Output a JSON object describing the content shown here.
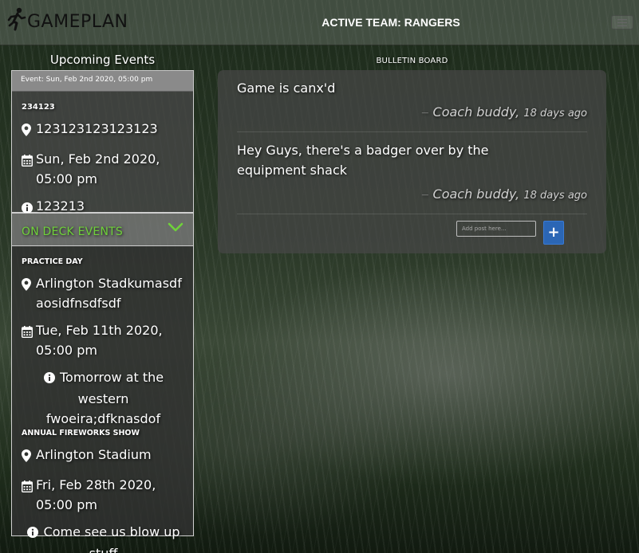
{
  "navbar": {
    "brand": "GAMEPLAN",
    "active_team": "ACTIVE TEAM: RANGERS"
  },
  "upcoming": {
    "heading": "Upcoming Events",
    "selected_label": "Event: Sun, Feb 2nd 2020, 05:00 pm",
    "event": {
      "title": "234123",
      "location": "123123123123123",
      "datetime": "Sun, Feb 2nd 2020, 05:00 pm",
      "info": "123213"
    }
  },
  "on_deck": {
    "heading": "ON DECK EVENTS",
    "accent": "#6fd13a",
    "events": [
      {
        "title": "PRACTICE DAY",
        "location": "Arlington Stadkumasdfaosidfnsdfsdf",
        "datetime": "Tue, Feb 11th 2020, 05:00 pm",
        "info": "Tomorrow at the western fwoeira;dfknasdof"
      },
      {
        "title": "ANNUAL FIREWORKS SHOW",
        "location": "Arlington Stadium",
        "datetime": "Fri, Feb 28th 2020, 05:00 pm",
        "info": "Come see us blow up stuff"
      }
    ]
  },
  "bulletin": {
    "heading": "BULLETIN BOARD",
    "posts": [
      {
        "text": "Game is canx'd",
        "dash": "—",
        "author": "Coach buddy,",
        "time": "18 days ago"
      },
      {
        "text": "Hey Guys, there's a badger over by the equipment shack",
        "dash": "—",
        "author": "Coach buddy,",
        "time": "18 days ago"
      }
    ],
    "input_placeholder": "Add post here...",
    "add_button_label": "+",
    "button_color": "#2b66b5"
  },
  "icons": {
    "brand": "runner-icon",
    "menu": "hamburger-menu-icon",
    "location": "map-marker-icon",
    "date": "calendar-icon",
    "info": "info-circle-icon",
    "expand": "chevron-down-icon"
  }
}
